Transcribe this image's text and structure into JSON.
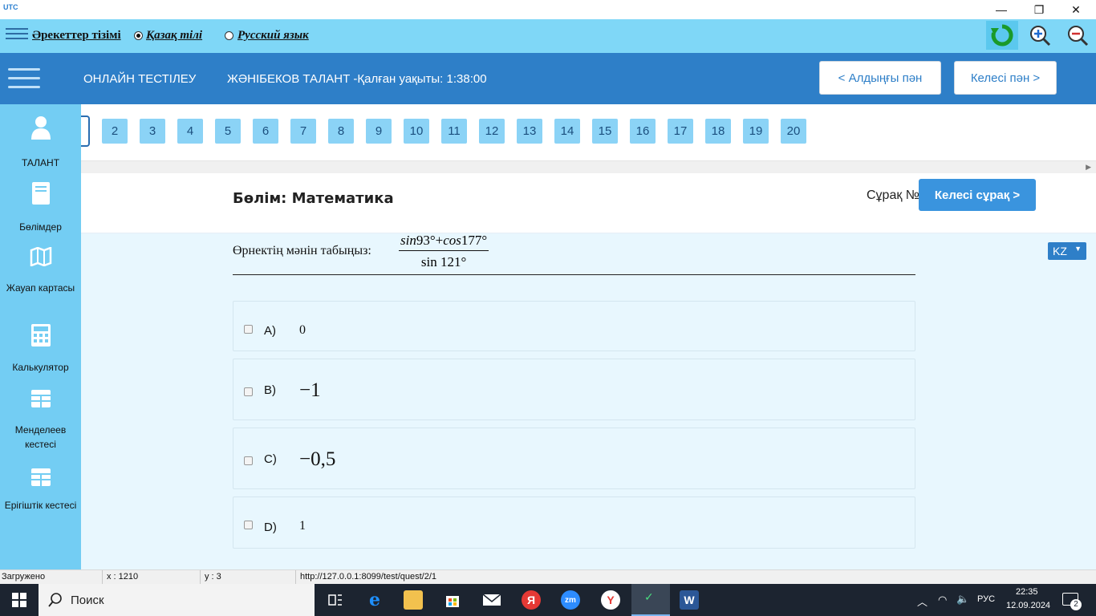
{
  "window": {
    "app_logo": "UTC",
    "minimize_icon": "—",
    "restore_icon": "❐",
    "close_icon": "✕"
  },
  "toolbar": {
    "actions_label": "Әрекеттер тізімі",
    "lang_kz": "Қазақ тілі",
    "lang_ru": "Русский язык",
    "selected_lang": "kz"
  },
  "header": {
    "title": "ОНЛАЙН ТЕСТІЛЕУ",
    "user_timer": "ЖӘНІБЕКОВ ТАЛАНТ -Қалған уақыты: 1:38:00",
    "prev_subject": "< Алдыңғы пән",
    "next_subject": "Келесі пән >"
  },
  "sidebar": {
    "items": [
      {
        "label": "ТАЛАНТ",
        "icon": "user-icon"
      },
      {
        "label": "Бөлімдер",
        "icon": "book-icon"
      },
      {
        "label": "Жауап картасы",
        "icon": "map-icon"
      },
      {
        "label": "Калькулятор",
        "icon": "calculator-icon"
      },
      {
        "label": "Менделеев кестесі",
        "icon": "table-icon"
      },
      {
        "label": "Ерігіштік кестесі",
        "icon": "table-icon"
      }
    ]
  },
  "question_numbers": [
    "2",
    "3",
    "4",
    "5",
    "6",
    "7",
    "8",
    "9",
    "10",
    "11",
    "12",
    "13",
    "14",
    "15",
    "16",
    "17",
    "18",
    "19",
    "20"
  ],
  "section": {
    "title": "Бөлім: Математика",
    "question_no_label": "Сұрақ №",
    "next_question": "Келесі сұрақ >"
  },
  "language_select": "KZ",
  "question": {
    "text": "Өрнектің мәнін табыңыз:",
    "numerator_sin": "sin",
    "numerator_a": "93°+",
    "numerator_cos": "cos",
    "numerator_b": "177°",
    "denominator": "sin 121°"
  },
  "options": [
    {
      "letter": "A)",
      "value": "0"
    },
    {
      "letter": "B)",
      "value": "−1"
    },
    {
      "letter": "C)",
      "value": "−0,5"
    },
    {
      "letter": "D)",
      "value": "1"
    }
  ],
  "statusbar": {
    "status": "Загружено",
    "x": "x : 1210",
    "y": "y : 3",
    "url": "http://127.0.0.1:8099/test/quest/2/1"
  },
  "taskbar": {
    "search_label": "Поиск",
    "lang": "РУС",
    "time": "22:35",
    "date": "12.09.2024",
    "notifications": "2"
  },
  "colors": {
    "toolbar_bg": "#7fd7f7",
    "header_bg": "#2e7fc8",
    "sidebar_bg": "#73cdf3",
    "qnum_bg": "#8bd3f6",
    "content_bg": "#e8f7fe",
    "accent_button": "#3a94de"
  }
}
